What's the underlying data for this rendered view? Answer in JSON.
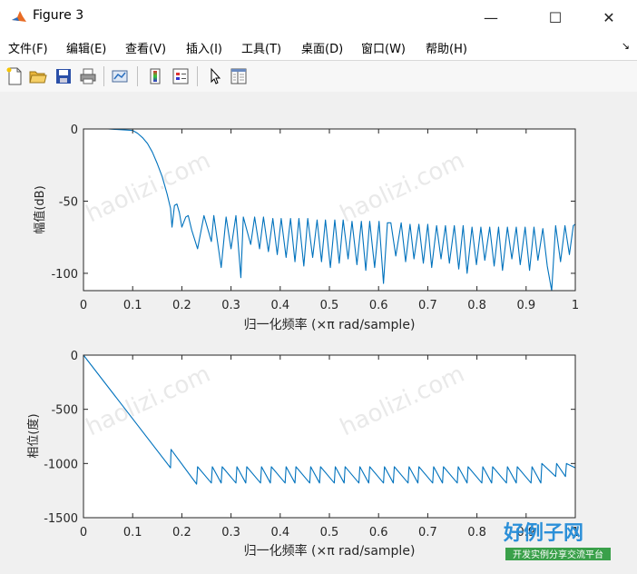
{
  "window": {
    "title": "Figure 3",
    "minimize": "—",
    "maximize": "☐",
    "close": "✕"
  },
  "menu": {
    "items": [
      "文件(F)",
      "编辑(E)",
      "查看(V)",
      "插入(I)",
      "工具(T)",
      "桌面(D)",
      "窗口(W)",
      "帮助(H)"
    ],
    "overflow_icon": "dock-arrow-icon"
  },
  "toolbar": {
    "icons": [
      "new-figure-icon",
      "open-file-icon",
      "save-icon",
      "print-icon",
      "link-plot-icon",
      "insert-colorbar-icon",
      "insert-legend-icon",
      "pointer-icon",
      "property-inspector-icon"
    ]
  },
  "watermark": {
    "site": "haolizi.com",
    "brand": "好例子网",
    "slogan": "开发实例分享交流平台"
  },
  "chart_data": [
    {
      "type": "line",
      "title": "",
      "xlabel": "归一化频率  (×π rad/sample)",
      "ylabel": "幅值(dB)",
      "xlim": [
        0,
        1
      ],
      "ylim": [
        -112,
        0
      ],
      "xticks": [
        0,
        0.1,
        0.2,
        0.3,
        0.4,
        0.5,
        0.6,
        0.7,
        0.8,
        0.9,
        1
      ],
      "xtick_labels": [
        "0",
        "0.1",
        "0.2",
        "0.3",
        "0.4",
        "0.5",
        "0.6",
        "0.7",
        "0.8",
        "0.9",
        "1"
      ],
      "yticks": [
        0,
        -50,
        -100
      ],
      "ytick_labels": [
        "0",
        "-50",
        "-100"
      ],
      "grid": false,
      "color": "#0072bd",
      "series": [
        {
          "x": [
            0,
            0.05,
            0.1,
            0.11,
            0.12,
            0.13,
            0.14,
            0.15,
            0.16,
            0.17,
            0.177,
            0.18,
            0.185,
            0.19,
            0.195,
            0.2,
            0.208,
            0.213,
            0.22,
            0.232,
            0.245,
            0.26,
            0.265,
            0.28,
            0.29,
            0.3,
            0.31,
            0.32,
            0.325,
            0.34,
            0.348,
            0.358,
            0.366,
            0.376,
            0.385,
            0.394,
            0.402,
            0.412,
            0.421,
            0.43,
            0.438,
            0.448,
            0.456,
            0.466,
            0.475,
            0.484,
            0.492,
            0.502,
            0.511,
            0.52,
            0.528,
            0.538,
            0.546,
            0.556,
            0.565,
            0.574,
            0.582,
            0.592,
            0.601,
            0.61,
            0.618,
            0.625,
            0.635,
            0.646,
            0.655,
            0.664,
            0.672,
            0.682,
            0.691,
            0.7,
            0.708,
            0.718,
            0.727,
            0.736,
            0.744,
            0.754,
            0.763,
            0.772,
            0.78,
            0.79,
            0.799,
            0.808,
            0.816,
            0.826,
            0.835,
            0.844,
            0.852,
            0.862,
            0.871,
            0.88,
            0.888,
            0.898,
            0.907,
            0.916,
            0.924,
            0.934,
            0.943,
            0.952,
            0.96,
            0.97,
            0.979,
            0.988,
            0.996,
            1
          ],
          "y": [
            0,
            0,
            -1,
            -3,
            -6,
            -10,
            -16,
            -24,
            -33,
            -45,
            -55,
            -68,
            -53,
            -52,
            -58,
            -68,
            -61,
            -60,
            -70,
            -83,
            -60,
            -78,
            -60,
            -96,
            -61,
            -83,
            -60,
            -103,
            -61,
            -80,
            -61,
            -83,
            -61,
            -85,
            -62,
            -87,
            -62,
            -89,
            -62,
            -92,
            -62,
            -95,
            -62,
            -89,
            -63,
            -92,
            -63,
            -96,
            -63,
            -93,
            -63,
            -90,
            -64,
            -94,
            -64,
            -98,
            -64,
            -96,
            -64,
            -107,
            -65,
            -65,
            -88,
            -65,
            -92,
            -66,
            -90,
            -66,
            -93,
            -66,
            -96,
            -67,
            -90,
            -67,
            -93,
            -67,
            -97,
            -67,
            -100,
            -68,
            -94,
            -68,
            -91,
            -68,
            -95,
            -68,
            -98,
            -68,
            -90,
            -68,
            -94,
            -68,
            -98,
            -68,
            -91,
            -69,
            -95,
            -112,
            -67,
            -92,
            -67,
            -87,
            -67,
            -66
          ]
        }
      ]
    },
    {
      "type": "line",
      "title": "",
      "xlabel": "归一化频率  (×π rad/sample)",
      "ylabel": "相位(度)",
      "xlim": [
        0,
        1
      ],
      "ylim": [
        -1500,
        0
      ],
      "xticks": [
        0,
        0.1,
        0.2,
        0.3,
        0.4,
        0.5,
        0.6,
        0.7,
        0.8,
        0.9,
        1
      ],
      "xtick_labels": [
        "0",
        "0.1",
        "0.2",
        "0.3",
        "0.4",
        "0.5",
        "0.6",
        "0.7",
        "0.8",
        "0.9",
        "1"
      ],
      "yticks": [
        0,
        -500,
        -1000,
        -1500
      ],
      "ytick_labels": [
        "0",
        "-500",
        "-1000",
        "-1500"
      ],
      "grid": false,
      "color": "#0072bd",
      "series": [
        {
          "x": [
            0,
            0.177,
            0.178,
            0.23,
            0.232,
            0.26,
            0.262,
            0.28,
            0.282,
            0.31,
            0.312,
            0.33,
            0.332,
            0.36,
            0.362,
            0.38,
            0.382,
            0.41,
            0.412,
            0.43,
            0.432,
            0.46,
            0.462,
            0.48,
            0.482,
            0.51,
            0.512,
            0.53,
            0.532,
            0.56,
            0.562,
            0.58,
            0.582,
            0.61,
            0.612,
            0.63,
            0.632,
            0.66,
            0.662,
            0.68,
            0.682,
            0.71,
            0.712,
            0.73,
            0.732,
            0.76,
            0.762,
            0.78,
            0.782,
            0.81,
            0.812,
            0.83,
            0.832,
            0.86,
            0.862,
            0.88,
            0.882,
            0.91,
            0.912,
            0.93,
            0.932,
            0.96,
            0.962,
            0.98,
            0.982,
            1.0
          ],
          "y": [
            0,
            -1040,
            -870,
            -1190,
            -1030,
            -1180,
            -1030,
            -1180,
            -1030,
            -1180,
            -1030,
            -1180,
            -1030,
            -1180,
            -1030,
            -1180,
            -1030,
            -1180,
            -1030,
            -1180,
            -1030,
            -1180,
            -1030,
            -1180,
            -1030,
            -1180,
            -1030,
            -1180,
            -1030,
            -1180,
            -1030,
            -1180,
            -1030,
            -1180,
            -1030,
            -1180,
            -1030,
            -1180,
            -1030,
            -1180,
            -1030,
            -1180,
            -1030,
            -1180,
            -1030,
            -1180,
            -1030,
            -1180,
            -1030,
            -1180,
            -1030,
            -1180,
            -1030,
            -1180,
            -1030,
            -1180,
            -1030,
            -1180,
            -1030,
            -1180,
            -1000,
            -1120,
            -1000,
            -1120,
            -1000,
            -1040
          ]
        }
      ]
    }
  ]
}
